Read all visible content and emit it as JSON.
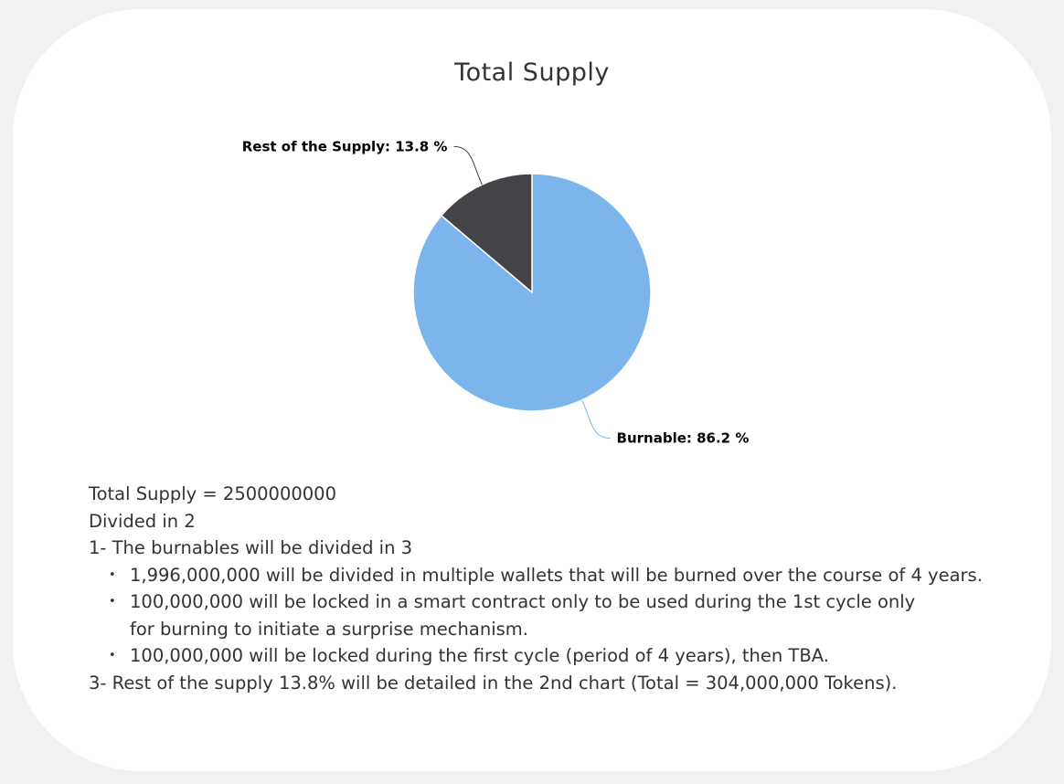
{
  "chart_data": {
    "type": "pie",
    "title": "Total Supply",
    "slices": [
      {
        "name": "Burnable",
        "value": 86.2,
        "label": "Burnable: 86.2 %",
        "color": "#7cb5ec"
      },
      {
        "name": "Rest of the Supply",
        "value": 13.8,
        "label": "Rest of the Supply: 13.8 %",
        "color": "#434348"
      }
    ],
    "start_angle": "12 o'clock, clockwise"
  },
  "description": {
    "line1": "Total Supply = 2500000000",
    "line2": "Divided in 2",
    "line3": "1- The burnables will be divided in 3",
    "bullets": [
      "1,996,000,000 will be divided in multiple wallets that will be burned over the course of 4 years.",
      "100,000,000 will be locked in a smart contract only to be used during the 1st cycle only for burning to initiate a surprise mechanism.",
      "100,000,000 will be locked during the first cycle (period of 4 years), then TBA."
    ],
    "bullet_symbol": "•",
    "line4": "3- Rest of the supply 13.8% will be detailed in the 2nd chart (Total = 304,000,000 Tokens)."
  }
}
